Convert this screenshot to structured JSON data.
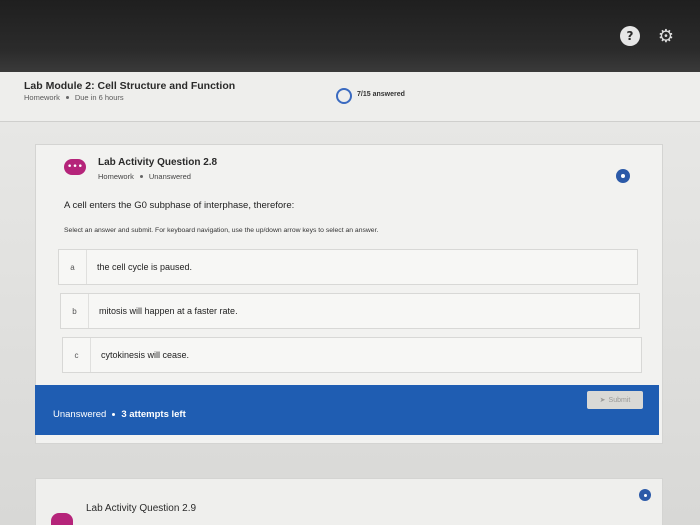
{
  "topbar": {
    "help_glyph": "?",
    "gear_glyph": "⚙"
  },
  "module": {
    "title": "Lab Module 2: Cell Structure and Function",
    "type": "Homework",
    "due": "Due in 6 hours",
    "progress": "7/15 answered"
  },
  "question": {
    "avatar": "•••",
    "title": "Lab Activity Question 2.8",
    "type": "Homework",
    "status": "Unanswered",
    "prompt": "A cell enters the G0 subphase of interphase, therefore:",
    "instructions": "Select an answer and submit. For keyboard navigation, use the up/down arrow keys to select an answer.",
    "answers": [
      {
        "letter": "a",
        "text": "the cell cycle is paused."
      },
      {
        "letter": "b",
        "text": "mitosis will happen at a faster rate."
      },
      {
        "letter": "c",
        "text": "cytokinesis will cease."
      }
    ]
  },
  "status_bar": {
    "state": "Unanswered",
    "attempts": "3 attempts left",
    "submit_label": "Submit",
    "submit_icon": "send-icon"
  },
  "next_question": {
    "title": "Lab Activity Question 2.9"
  },
  "colors": {
    "accent": "#1f5db2",
    "avatar": "#b5247a"
  }
}
